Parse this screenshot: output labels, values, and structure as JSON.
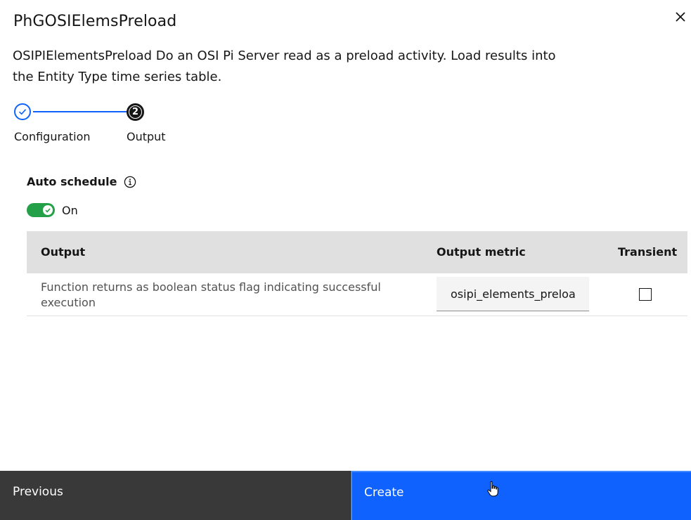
{
  "modal": {
    "title": "PhGOSIElemsPreload",
    "description": "OSIPIElementsPreload Do an OSI Pi Server read as a preload activity. Load results into the Entity Type time series table.",
    "close_icon": "close-icon"
  },
  "progress": {
    "steps": [
      {
        "label": "Configuration",
        "state": "complete"
      },
      {
        "label": "Output",
        "state": "current",
        "number": "2"
      }
    ]
  },
  "auto_schedule": {
    "label": "Auto schedule",
    "toggle_text": "On",
    "enabled": true
  },
  "table": {
    "headers": {
      "output": "Output",
      "metric": "Output metric",
      "transient": "Transient"
    },
    "rows": [
      {
        "output": "Function returns as boolean status flag indicating successful execution",
        "metric": "osipi_elements_preload",
        "transient": false
      }
    ]
  },
  "footer": {
    "previous_label": "Previous",
    "create_label": "Create"
  },
  "colors": {
    "accent": "#0f62fe",
    "toggle_on": "#24a148",
    "secondary_button": "#393939",
    "table_header": "#e0e0e0"
  }
}
